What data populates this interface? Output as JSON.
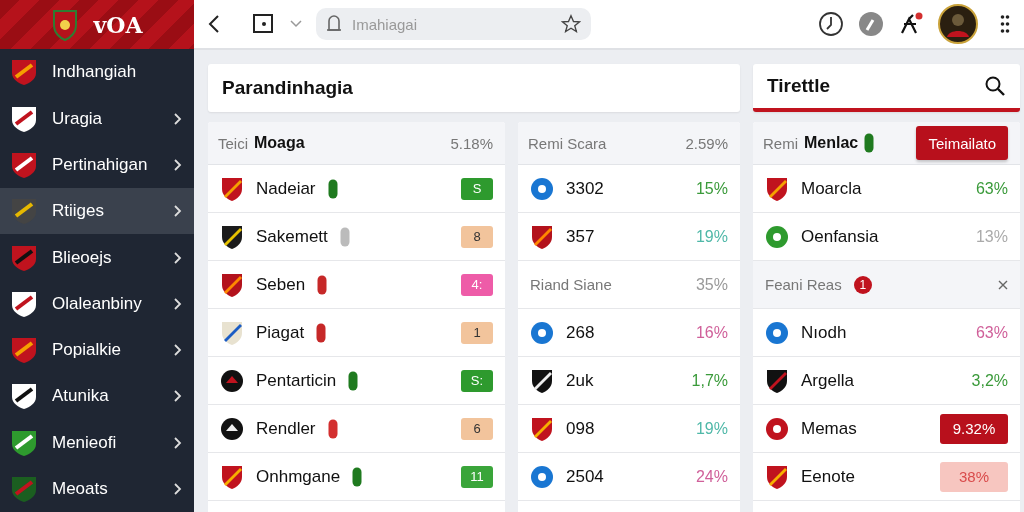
{
  "sidebar": {
    "logo_text": "vOA",
    "items": [
      {
        "label": "Indhangiah",
        "selected": false,
        "chevron": false
      },
      {
        "label": "Uragia",
        "selected": false,
        "chevron": true
      },
      {
        "label": "Pertinahigan",
        "selected": false,
        "chevron": true
      },
      {
        "label": "Rtiiges",
        "selected": true,
        "chevron": true
      },
      {
        "label": "Blieoejs",
        "selected": false,
        "chevron": true
      },
      {
        "label": "Olaleanbiny",
        "selected": false,
        "chevron": true
      },
      {
        "label": "Popialkie",
        "selected": false,
        "chevron": true
      },
      {
        "label": "Atunika",
        "selected": false,
        "chevron": true
      },
      {
        "label": "Menieofi",
        "selected": false,
        "chevron": true
      },
      {
        "label": "Meoats",
        "selected": false,
        "chevron": true
      }
    ]
  },
  "toolbar": {
    "address": {
      "placeholder": "Imahiagai"
    }
  },
  "title_card": {
    "title": "Parandinhagia"
  },
  "search_card": {
    "title": "Tirettle"
  },
  "column_1": {
    "header": {
      "label": "Teici",
      "bold": "Moaga",
      "value": "5.18%"
    },
    "rows": [
      {
        "name": "Nadeiar",
        "tag": {
          "color": "#1f7a1f"
        },
        "badge": "S",
        "color": "#2e9a2e"
      },
      {
        "name": "Sakemett",
        "tag": {
          "color": "#bbbbbb"
        },
        "badge": "8",
        "color": "#f2c49c"
      },
      {
        "name": "Seben",
        "tag": {
          "color": "#c62828"
        },
        "badge": "4:",
        "color": "#ee5ca8"
      },
      {
        "name": "Piagat",
        "tag": {
          "color": "#c62828"
        },
        "badge": "1",
        "color": "#f2c49c"
      },
      {
        "name": "Pentarticin",
        "tag": {
          "color": "#1f7a1f"
        },
        "badge": "S:",
        "color": "#2e9a2e"
      },
      {
        "name": "Rendler",
        "tag": {
          "color": "#d32f2f"
        },
        "badge": "6",
        "color": "#f2c49c"
      },
      {
        "name": "Onhmgane",
        "tag": {
          "color": "#1f7a1f"
        },
        "badge": "11",
        "color": "#3aa53a"
      }
    ]
  },
  "column_2": {
    "header": {
      "label": "Remi Scara",
      "value": "2.59%"
    },
    "rows": [
      {
        "kind": "row",
        "name": "3302",
        "value": "15%",
        "color": "#3a9a3a"
      },
      {
        "kind": "row",
        "name": "357",
        "value": "19%",
        "color": "#4fb8a8"
      },
      {
        "kind": "subheader",
        "name": "Riand Siane",
        "value": "35%",
        "color": "#999999"
      },
      {
        "kind": "row",
        "name": "268",
        "value": "16%",
        "color": "#d0609a"
      },
      {
        "kind": "row",
        "name": "2uk",
        "value": "1,7%",
        "color": "#3a9a3a"
      },
      {
        "kind": "row",
        "name": "098",
        "value": "19%",
        "color": "#4fb8a8"
      },
      {
        "kind": "row",
        "name": "2504",
        "value": "24%",
        "color": "#d0609a"
      }
    ]
  },
  "column_3": {
    "header": {
      "label": "Remi",
      "bold": "Menlac",
      "button": "Teimailato"
    },
    "rows": [
      {
        "kind": "row",
        "name": "Moarcla",
        "value": "63%",
        "color": "#3a9a3a"
      },
      {
        "kind": "row",
        "name": "Oenfansia",
        "value": "13%",
        "color": "#aaaaaa"
      },
      {
        "kind": "subheader",
        "name": "Feani Reas",
        "count": "1"
      },
      {
        "kind": "row",
        "name": "Nıodh",
        "value": "63%",
        "color": "#d0609a"
      },
      {
        "kind": "row",
        "name": "Argella",
        "value": "3,2%",
        "color": "#3a9a3a"
      },
      {
        "kind": "highlight",
        "name": "Memas",
        "value": "9.32%",
        "color": "#b8101c"
      },
      {
        "kind": "soft",
        "name": "Eenote",
        "value": "38%",
        "color": "#f7c6c0"
      }
    ]
  }
}
